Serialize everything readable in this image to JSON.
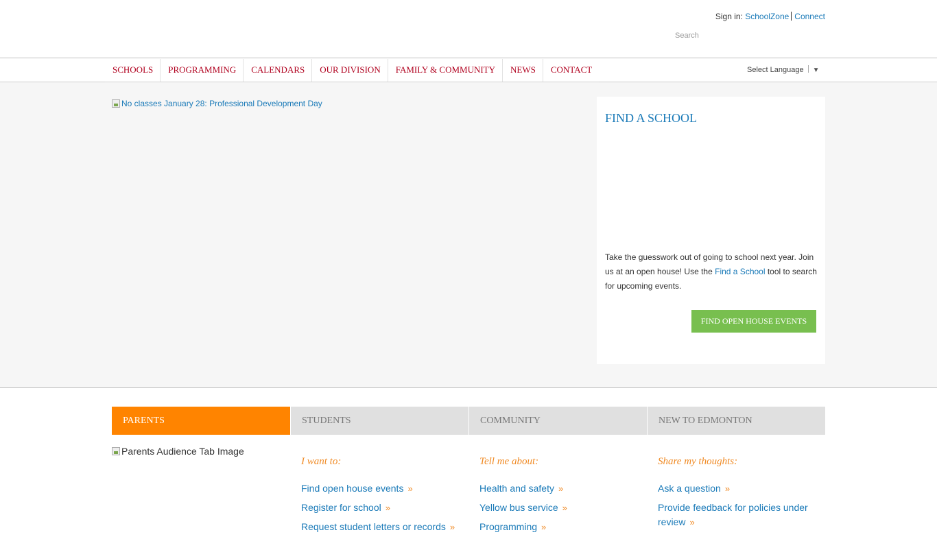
{
  "header": {
    "signin_label": "Sign in:",
    "schoolzone": "SchoolZone",
    "connect": "Connect",
    "search_placeholder": "Search"
  },
  "nav": {
    "items": [
      "SCHOOLS",
      "PROGRAMMING",
      "CALENDARS",
      "OUR DIVISION",
      "FAMILY & COMMUNITY",
      "NEWS",
      "CONTACT"
    ],
    "language_label": "Select Language",
    "language_arrow": "▼"
  },
  "hero": {
    "image_alt": "No classes January 28: Professional Development Day"
  },
  "find_school": {
    "title": "FIND A SCHOOL",
    "text_before": "Take the guesswork out of going to school next year. Join us at an open house! Use the ",
    "link": "Find a School",
    "text_after": " tool to search for upcoming events.",
    "button": "FIND OPEN HOUSE EVENTS"
  },
  "audience": {
    "tabs": [
      "PARENTS",
      "STUDENTS",
      "COMMUNITY",
      "NEW TO EDMONTON"
    ],
    "active_tab": "PARENTS",
    "tab_image_alt": "Parents Audience Tab Image",
    "columns": [
      {
        "heading": "I want to:",
        "links": [
          "Find open house events",
          "Register for school",
          "Request student letters or records"
        ]
      },
      {
        "heading": "Tell me about:",
        "links": [
          "Health and safety",
          "Yellow bus service",
          "Programming"
        ]
      },
      {
        "heading": "Share my thoughts:",
        "links": [
          "Ask a question",
          "Provide feedback for policies under review"
        ]
      }
    ],
    "link_chevron": "»"
  },
  "colors": {
    "nav_text": "#b0001e",
    "link": "#1a7ab8",
    "accent_orange": "#ff8400",
    "button_green": "#78bf4f"
  }
}
